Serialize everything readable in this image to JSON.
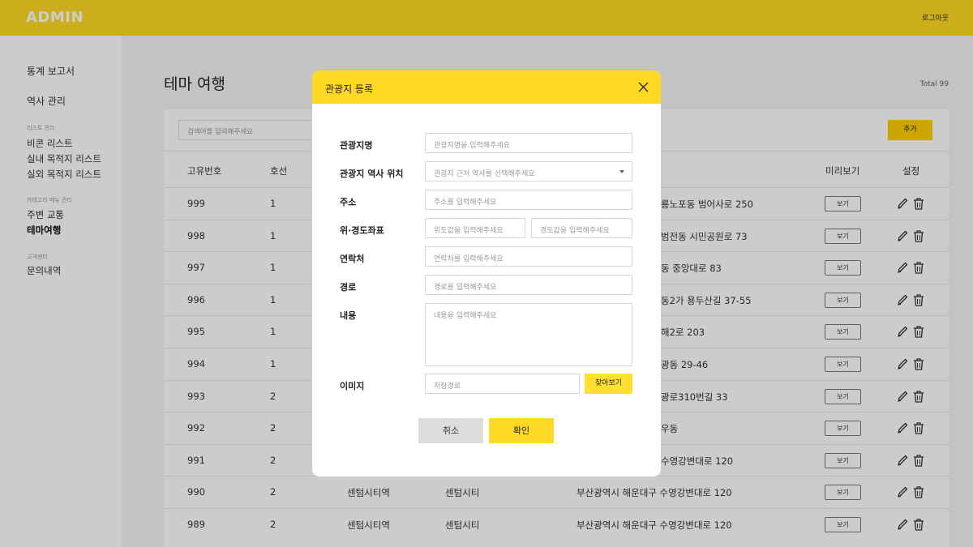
{
  "header": {
    "brand": "ADMIN",
    "logout": "로그아웃"
  },
  "sidebar": {
    "main_items": [
      "통계 보고서",
      "역사 관리"
    ],
    "list_category": "리스트 관리",
    "list_items": [
      "비콘 리스트",
      "실내 목적지 리스트",
      "실외 목적지 리스트"
    ],
    "menu_category": "카테고리 메뉴 관리",
    "menu_items": [
      "주변 교통",
      "테마여행"
    ],
    "active_item": "테마여행",
    "support_category": "고객센터",
    "support_items": [
      "문의내역"
    ]
  },
  "page": {
    "title": "테마 여행",
    "total": "Total 99",
    "search_placeholder": "검색어를 입력해주세요",
    "add_label": "추가"
  },
  "table": {
    "columns": {
      "id": "고유번호",
      "line": "호선",
      "preview": "미리보기",
      "settings": "설정"
    },
    "view_label": "보기",
    "rows": [
      {
        "id": "999",
        "line": "1",
        "station": "",
        "name": "",
        "address": "룡노포동 범어사로 250"
      },
      {
        "id": "998",
        "line": "1",
        "station": "",
        "name": "",
        "address": "범전동 시민공원로 73"
      },
      {
        "id": "997",
        "line": "1",
        "station": "",
        "name": "",
        "address": "동 중앙대로 83"
      },
      {
        "id": "996",
        "line": "1",
        "station": "",
        "name": "",
        "address": "동2가 용두산길 37-55"
      },
      {
        "id": "995",
        "line": "1",
        "station": "",
        "name": "",
        "address": "해2로 203"
      },
      {
        "id": "994",
        "line": "1",
        "station": "",
        "name": "",
        "address": "광동 29-46"
      },
      {
        "id": "993",
        "line": "2",
        "station": "",
        "name": "",
        "address": "광로310번길 33"
      },
      {
        "id": "992",
        "line": "2",
        "station": "",
        "name": "",
        "address": "우동"
      },
      {
        "id": "991",
        "line": "2",
        "station": "",
        "name": "",
        "address": "수영강변대로 120"
      },
      {
        "id": "990",
        "line": "2",
        "station": "센텀시티역",
        "name": "센텀시티",
        "address": "부산광역시 해운대구 수영강변대로 120"
      },
      {
        "id": "989",
        "line": "2",
        "station": "센텀시티역",
        "name": "센텀시티",
        "address": "부산광역시 해운대구 수영강변대로 120"
      }
    ]
  },
  "modal": {
    "title": "관광지 등록",
    "fields": {
      "name": {
        "label": "관광지명",
        "placeholder": "관광지명을 입력해주세요"
      },
      "station": {
        "label": "관광지 역사 위치",
        "placeholder": "관광지 근처 역사를 선택해주세요"
      },
      "address": {
        "label": "주소",
        "placeholder": "주소를 입력해주세요"
      },
      "coords": {
        "label": "위·경도좌표",
        "lat_placeholder": "위도값을 입력해주세요",
        "lng_placeholder": "경도값을 입력해주세요"
      },
      "contact": {
        "label": "연락처",
        "placeholder": "연락처를 입력해주세요"
      },
      "route": {
        "label": "경로",
        "placeholder": "경로를 입력해주세요"
      },
      "content": {
        "label": "내용",
        "placeholder": "내용을 입력해주세요"
      },
      "image": {
        "label": "이미지",
        "placeholder": "저장경로",
        "browse_label": "찾아보기"
      }
    },
    "cancel_label": "취소",
    "confirm_label": "확인"
  }
}
